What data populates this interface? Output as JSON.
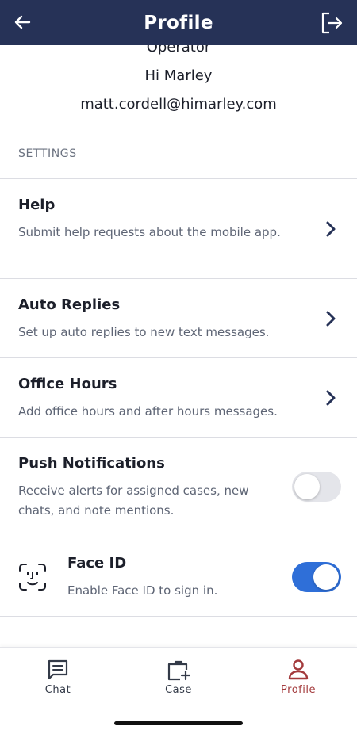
{
  "header": {
    "title": "Profile",
    "back_icon": "arrow-left-icon",
    "logout_icon": "logout-icon",
    "background": "#263257"
  },
  "profile": {
    "role": "Operator",
    "greeting": "Hi Marley",
    "email": "matt.cordell@himarley.com"
  },
  "settings": {
    "section_label": "SETTINGS",
    "items": [
      {
        "title": "Help",
        "description": "Submit help requests about the mobile app.",
        "control": "chevron"
      },
      {
        "title": "Auto Replies",
        "description": "Set up auto replies to new text messages.",
        "control": "chevron"
      },
      {
        "title": "Office Hours",
        "description": "Add office hours and after hours messages.",
        "control": "chevron"
      },
      {
        "title": "Push Notifications",
        "description": "Receive alerts for assigned cases, new chats, and note mentions.",
        "control": "toggle",
        "enabled": false
      },
      {
        "title": "Face ID",
        "description": "Enable Face ID to sign in.",
        "control": "toggle",
        "enabled": true,
        "icon": "face-id-icon"
      }
    ]
  },
  "bottom_nav": {
    "items": [
      {
        "label": "Chat",
        "icon": "chat-icon",
        "active": false
      },
      {
        "label": "Case",
        "icon": "case-add-icon",
        "active": false
      },
      {
        "label": "Profile",
        "icon": "profile-icon",
        "active": true
      }
    ]
  },
  "colors": {
    "accent_blue": "#2f6fd8",
    "active_red": "#a33a3c",
    "toggle_off": "#e4e5ea"
  }
}
